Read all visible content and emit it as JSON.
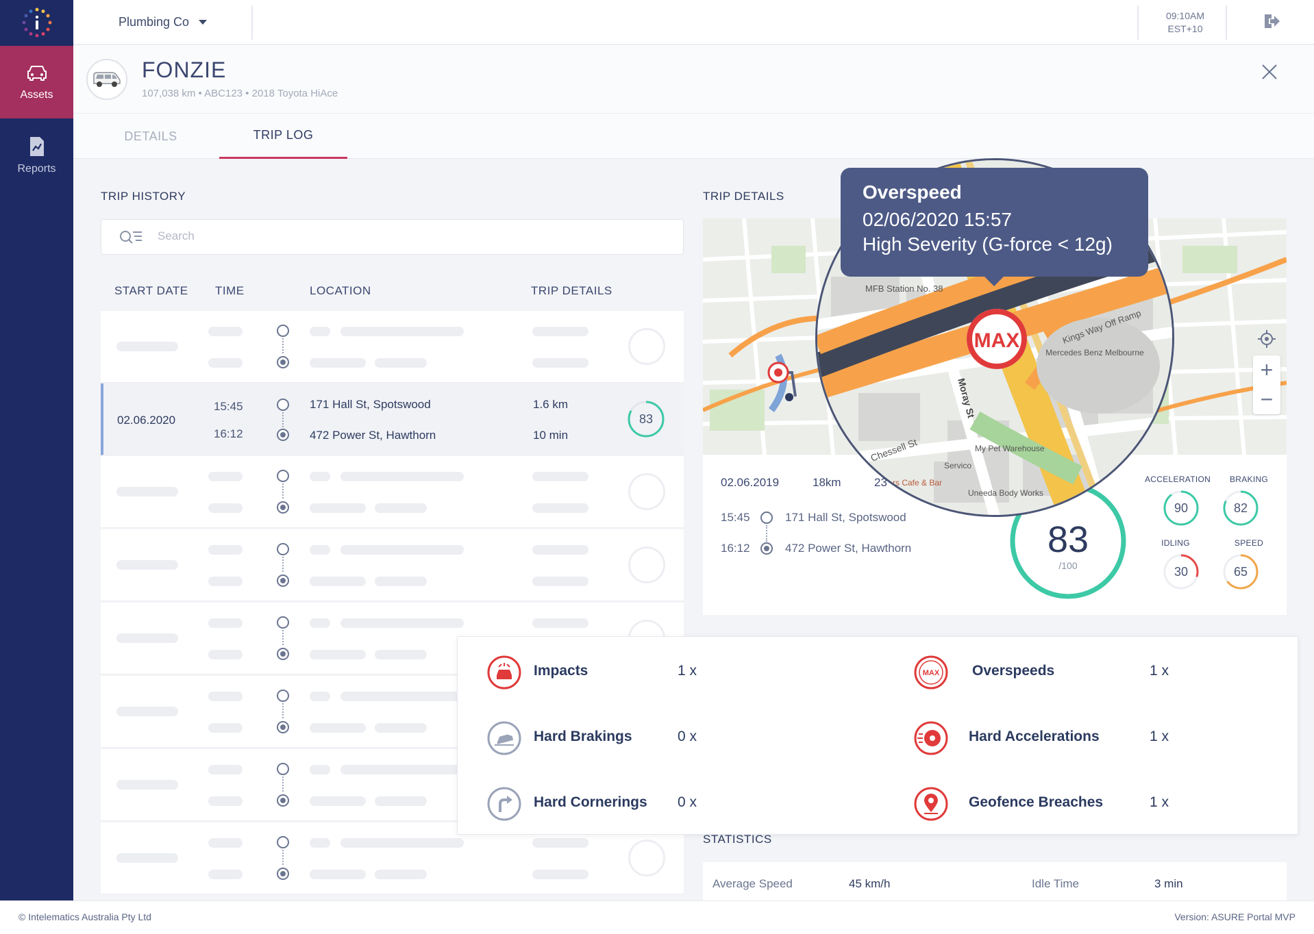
{
  "sidebar": {
    "items": [
      {
        "label": "Assets",
        "icon": "car-icon",
        "active": true
      },
      {
        "label": "Reports",
        "icon": "report-icon",
        "active": false
      }
    ]
  },
  "header": {
    "company": "Plumbing Co",
    "time": "09:10AM",
    "timezone": "EST+10"
  },
  "asset": {
    "name": "FONZIE",
    "subtitle": "107,038 km • ABC123 • 2018 Toyota HiAce"
  },
  "tabs": [
    {
      "label": "DETAILS",
      "active": false
    },
    {
      "label": "TRIP LOG",
      "active": true
    }
  ],
  "trip_history": {
    "title": "TRIP HISTORY",
    "search_placeholder": "Search",
    "columns": [
      "START DATE",
      "TIME",
      "LOCATION",
      "TRIP DETAILS"
    ],
    "selected": {
      "date": "02.06.2020",
      "start_time": "15:45",
      "end_time": "16:12",
      "from": "171 Hall St, Spotswood",
      "to": "472 Power St, Hawthorn",
      "distance": "1.6 km",
      "duration": "10 min",
      "score": "83",
      "score_value": 83
    }
  },
  "trip_details": {
    "title": "TRIP DETAILS",
    "date": "02.06.2019",
    "distance": "18km",
    "duration": "23",
    "start_time": "15:45",
    "end_time": "16:12",
    "from": "171 Hall St, Spotswood",
    "to": "472 Power St, Hawthorn",
    "score": "83",
    "score_value": 83,
    "score_max": "/100",
    "metrics": [
      {
        "label": "ACCELERATION",
        "value": "90",
        "color": "#3dc9a6"
      },
      {
        "label": "BRAKING",
        "value": "82",
        "color": "#3dc9a6"
      },
      {
        "label": "IDLING",
        "value": "30",
        "color": "#e64a4a"
      },
      {
        "label": "SPEED",
        "value": "65",
        "color": "#f0a64a"
      }
    ]
  },
  "map_labels": {
    "poi1": "MFB Station No. 38",
    "poi2": "Kings Way Off Ramp",
    "poi3": "Mercedes Benz Melbourne",
    "poi4": "Moray St",
    "poi5": "Chessell St",
    "poi6": "My Pet Warehouse",
    "poi7": "Servico",
    "poi8": "Uneeda Body Works",
    "poi9": "rs Cafe & Bar"
  },
  "tooltip": {
    "title": "Overspeed",
    "datetime": "02/06/2020 15:57",
    "severity": "High Severity (G-force < 12g)",
    "badge": "MAX"
  },
  "events": [
    {
      "label": "Impacts",
      "count": "1 x",
      "icon": "impact-icon",
      "color": "#e03a3a"
    },
    {
      "label": "Overspeeds",
      "count": "1 x",
      "icon": "max-speed-icon",
      "color": "#e03a3a"
    },
    {
      "label": "Hard Brakings",
      "count": "0 x",
      "icon": "brake-icon",
      "color": "#9aa3b8"
    },
    {
      "label": "Hard Accelerations",
      "count": "1 x",
      "icon": "acceleration-icon",
      "color": "#e03a3a"
    },
    {
      "label": "Hard Cornerings",
      "count": "0 x",
      "icon": "corner-icon",
      "color": "#9aa3b8"
    },
    {
      "label": "Geofence Breaches",
      "count": "1 x",
      "icon": "geofence-icon",
      "color": "#e03a3a"
    }
  ],
  "statistics": {
    "title": "STATISTICS",
    "avg_speed_label": "Average Speed",
    "avg_speed": "45 km/h",
    "idle_label": "Idle Time",
    "idle": "3 min"
  },
  "footer": {
    "copyright": "© Intelematics Australia Pty Ltd",
    "version": "Version: ASURE Portal MVP"
  }
}
